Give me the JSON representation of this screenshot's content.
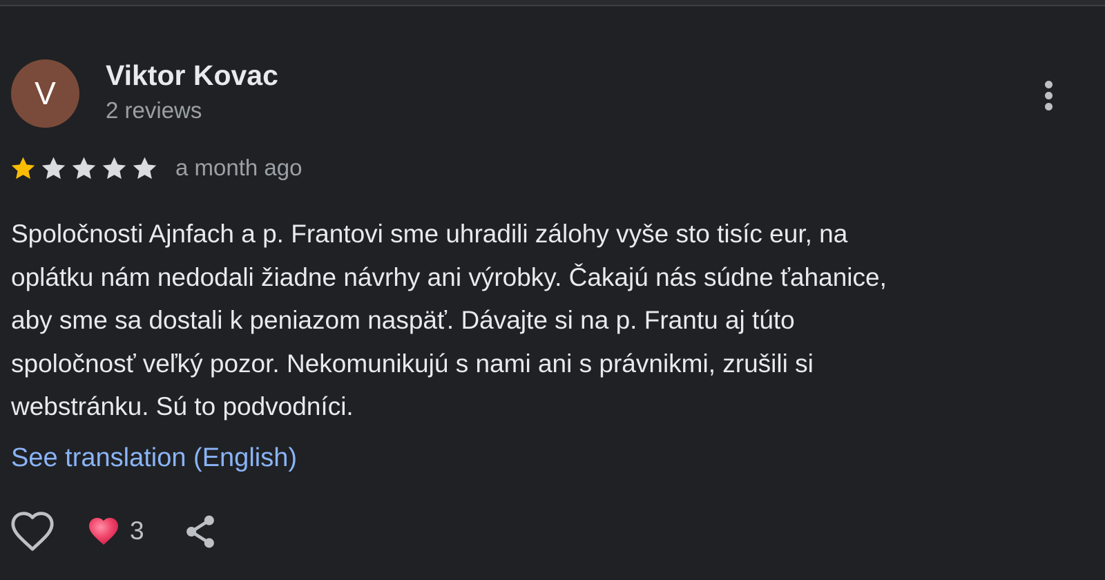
{
  "review": {
    "avatar_initial": "V",
    "avatar_color": "#7a4b3a",
    "reviewer_name": "Viktor Kovac",
    "review_count": "2 reviews",
    "rating": 1,
    "rating_max": 5,
    "date": "a month ago",
    "text_lines": [
      "Spoločnosti Ajnfach a p. Frantovi sme uhradili zálohy vyše sto tisíc eur, na",
      "oplátku nám nedodali žiadne návrhy ani výrobky. Čakajú nás súdne ťahanice,",
      "aby sme sa dostali k peniazom naspäť. Dávajte si na p. Frantu aj túto",
      "spoločnosť veľký pozor. Nekomunikujú s nami ani s právnikmi, zrušili si",
      "webstránku. Sú to podvodníci."
    ],
    "translation_link": "See translation (English)",
    "reaction_count": "3"
  },
  "icons": {
    "more": "more-vert-icon",
    "star_filled": "star-filled-icon",
    "star_empty": "star-empty-icon",
    "like": "heart-outline-icon",
    "reaction": "heart-filled-icon",
    "share": "share-icon"
  },
  "colors": {
    "background": "#202124",
    "text": "#e8eaed",
    "secondary_text": "#9aa0a6",
    "link": "#8ab4f8",
    "star_filled": "#fbbc04",
    "star_empty": "#dadce0",
    "heart": "#e8395c"
  }
}
